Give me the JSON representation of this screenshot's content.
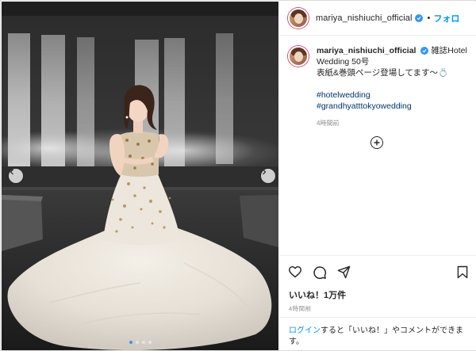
{
  "post": {
    "username": "mariya_nishiuchi_official",
    "header_separator": "•",
    "follow_label": "フォロ",
    "caption_line1": "雑誌Hotel",
    "caption_line2": "Wedding 50号",
    "caption_line3": "表紙&巻頭ページ登場してます〜💍",
    "hashtags": [
      "#hotelwedding",
      "#grandhyatttokyowedding"
    ],
    "caption_time": "4時間前",
    "likes": "いいね！1万件",
    "time": "4時間前",
    "login_link": "ログイン",
    "login_text": "すると「いいね！」やコメントができます。"
  },
  "carousel": {
    "slides": 4,
    "active_index": 0
  },
  "colors": {
    "accent": "#0095f6",
    "verified": "#3897f0",
    "hashtag": "#00376b",
    "muted": "#8e8e8e"
  },
  "icons": [
    "verified-badge-icon",
    "add-comment-icon",
    "heart-icon",
    "comment-icon",
    "share-icon",
    "bookmark-icon",
    "chevron-left-icon",
    "chevron-right-icon"
  ]
}
